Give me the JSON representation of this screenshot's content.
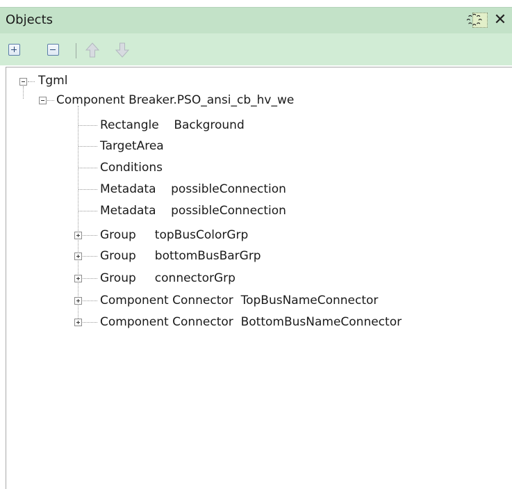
{
  "panel": {
    "title": "Objects",
    "pin_glyph": "҈",
    "close_glyph": "✕"
  },
  "toolbar": {
    "buttons": [
      {
        "name": "expand-all-button",
        "icon": "plus-box-icon"
      },
      {
        "name": "collapse-all-button",
        "icon": "minus-box-icon"
      },
      {
        "name": "move-up-button",
        "icon": "arrow-up-icon"
      },
      {
        "name": "move-down-button",
        "icon": "arrow-down-icon"
      }
    ],
    "accent_color": "#c3e2c8"
  },
  "tree": {
    "root": {
      "type": "Tgml",
      "name": "",
      "expanded": true
    },
    "component": {
      "type": "Component",
      "name": "Breaker.PSO_ansi_cb_hv_we",
      "expanded": true
    },
    "children": [
      {
        "type": "Rectangle",
        "name": "Background",
        "expandable": false
      },
      {
        "type": "TargetArea",
        "name": "",
        "expandable": false
      },
      {
        "type": "Conditions",
        "name": "",
        "expandable": false
      },
      {
        "type": "Metadata",
        "name": "possibleConnection",
        "expandable": false
      },
      {
        "type": "Metadata",
        "name": "possibleConnection",
        "expandable": false
      },
      {
        "type": "Group",
        "name": "topBusColorGrp",
        "expandable": true
      },
      {
        "type": "Group",
        "name": "bottomBusBarGrp",
        "expandable": true
      },
      {
        "type": "Group",
        "name": "connectorGrp",
        "expandable": true
      },
      {
        "type": "Component",
        "name": "Connector  TopBusNameConnector",
        "expandable": true
      },
      {
        "type": "Component",
        "name": "Connector  BottomBusNameConnector",
        "expandable": true
      }
    ]
  }
}
